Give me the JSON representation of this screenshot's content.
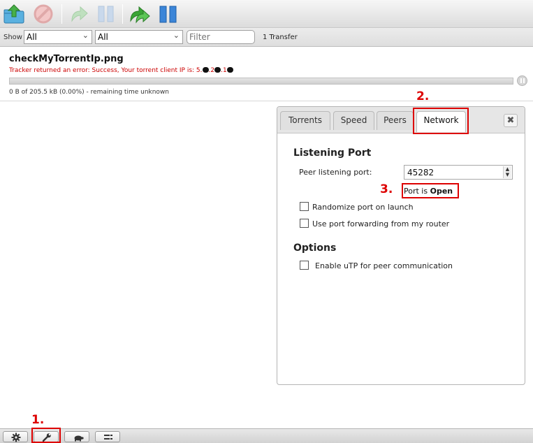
{
  "toolbar": {
    "buttons": [
      {
        "icon": "open-torrent-icon"
      },
      {
        "icon": "remove-icon"
      },
      {
        "icon": "resume-icon"
      },
      {
        "icon": "pause-icon"
      },
      {
        "icon": "resume-all-icon"
      },
      {
        "icon": "pause-all-icon"
      }
    ]
  },
  "filterbar": {
    "show_label": "Show",
    "state_filter": "All",
    "tracker_filter": "All",
    "filter_placeholder": "Filter",
    "transfer_count": "1 Transfer"
  },
  "torrent": {
    "name": "checkMyTorrentIp.png",
    "error_prefix": "Tracker returned an error: Success, Your torrent client IP is: 5.",
    "error_mid1": ".2",
    "error_mid2": ".1",
    "progress": 0,
    "status": "0 B of 205.5 kB (0.00%) - remaining time unknown"
  },
  "prefs": {
    "tabs": [
      "Torrents",
      "Speed",
      "Peers",
      "Network"
    ],
    "active_tab": "Network",
    "close_label": "✖",
    "listening_port_title": "Listening Port",
    "peer_port_label": "Peer listening port:",
    "peer_port_value": "45282",
    "port_status_prefix": "Port is ",
    "port_status_value": "Open",
    "randomize_label": "Randomize port on launch",
    "forwarding_label": "Use port forwarding from my router",
    "options_title": "Options",
    "utp_label": "Enable uTP for peer communication"
  },
  "annotations": {
    "one": "1.",
    "two": "2.",
    "three": "3."
  },
  "bottombar": {
    "buttons": [
      "settings-icon",
      "wrench-icon",
      "turtle-icon",
      "list-icon"
    ]
  },
  "colors": {
    "annotation": "#dd0000",
    "error_text": "#cc0000",
    "toolbar_green": "#3aa535",
    "toolbar_blue": "#2a72c8"
  }
}
